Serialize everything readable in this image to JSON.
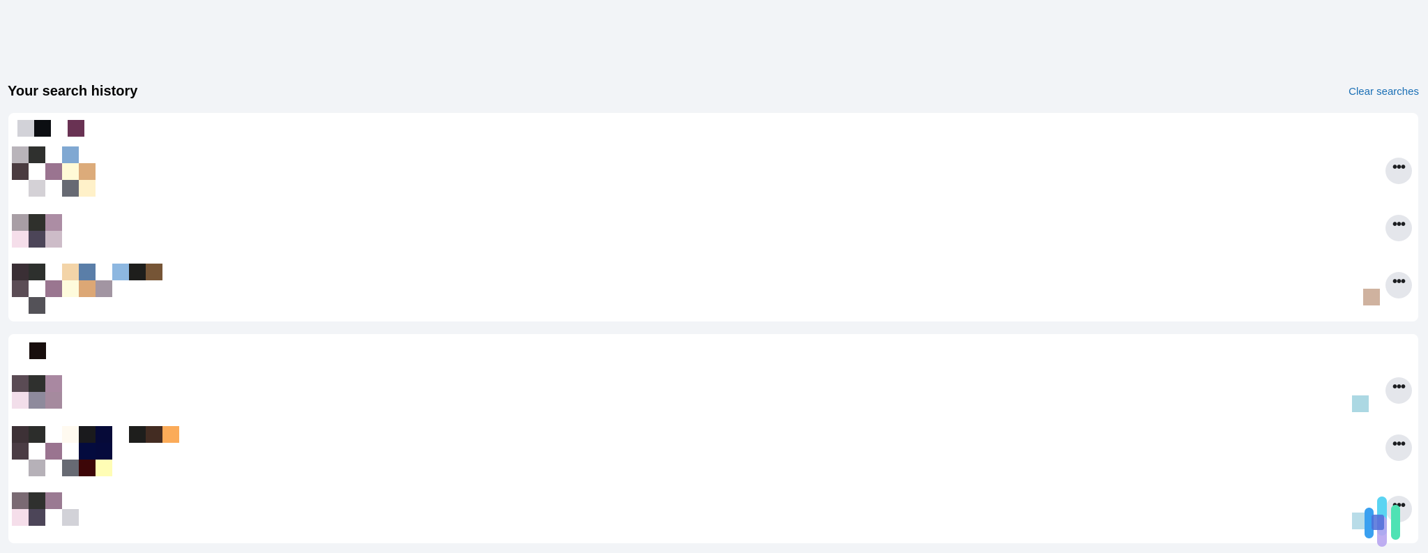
{
  "section": {
    "title": "Your search history",
    "clear_label": "Clear searches"
  },
  "icons": {
    "more": "more-horizontal-icon",
    "logo": "app-logo-icon"
  },
  "more_button_glyph": "•••",
  "colors": {
    "background": "#f2f4f7",
    "card": "#ffffff",
    "link": "#1a6fb5",
    "button": "#e4e6eb"
  }
}
